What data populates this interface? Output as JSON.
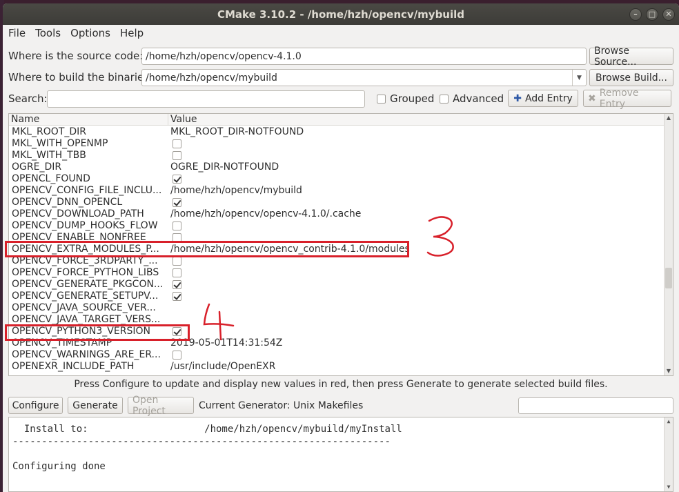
{
  "window": {
    "title": "CMake 3.10.2 - /home/hzh/opencv/mybuild"
  },
  "menu": [
    "File",
    "Tools",
    "Options",
    "Help"
  ],
  "source": {
    "label": "Where is the source code:",
    "value": "/home/hzh/opencv/opencv-4.1.0",
    "button": "Browse Source..."
  },
  "build": {
    "label": "Where to build the binaries:",
    "value": "/home/hzh/opencv/mybuild",
    "button": "Browse Build..."
  },
  "search": {
    "label": "Search:",
    "value": "",
    "grouped": "Grouped",
    "advanced": "Advanced",
    "add_entry": "Add Entry",
    "remove_entry": "Remove Entry"
  },
  "table": {
    "headers": {
      "name": "Name",
      "value": "Value"
    },
    "rows": [
      {
        "name": "MKL_ROOT_DIR",
        "type": "text",
        "value": "MKL_ROOT_DIR-NOTFOUND"
      },
      {
        "name": "MKL_WITH_OPENMP",
        "type": "bool",
        "checked": false
      },
      {
        "name": "MKL_WITH_TBB",
        "type": "bool",
        "checked": false
      },
      {
        "name": "OGRE_DIR",
        "type": "text",
        "value": "OGRE_DIR-NOTFOUND"
      },
      {
        "name": "OPENCL_FOUND",
        "type": "bool",
        "checked": true
      },
      {
        "name": "OPENCV_CONFIG_FILE_INCLU...",
        "type": "text",
        "value": "/home/hzh/opencv/mybuild"
      },
      {
        "name": "OPENCV_DNN_OPENCL",
        "type": "bool",
        "checked": true
      },
      {
        "name": "OPENCV_DOWNLOAD_PATH",
        "type": "text",
        "value": "/home/hzh/opencv/opencv-4.1.0/.cache"
      },
      {
        "name": "OPENCV_DUMP_HOOKS_FLOW",
        "type": "bool",
        "checked": false
      },
      {
        "name": "OPENCV_ENABLE_NONFREE",
        "type": "bool",
        "checked": false
      },
      {
        "name": "OPENCV_EXTRA_MODULES_P...",
        "type": "text",
        "value": "/home/hzh/opencv/opencv_contrib-4.1.0/modules"
      },
      {
        "name": "OPENCV_FORCE_3RDPARTY_...",
        "type": "bool",
        "checked": false
      },
      {
        "name": "OPENCV_FORCE_PYTHON_LIBS",
        "type": "bool",
        "checked": false
      },
      {
        "name": "OPENCV_GENERATE_PKGCON...",
        "type": "bool",
        "checked": true
      },
      {
        "name": "OPENCV_GENERATE_SETUPV...",
        "type": "bool",
        "checked": true
      },
      {
        "name": "OPENCV_JAVA_SOURCE_VER...",
        "type": "text",
        "value": ""
      },
      {
        "name": "OPENCV_JAVA_TARGET_VERS...",
        "type": "text",
        "value": ""
      },
      {
        "name": "OPENCV_PYTHON3_VERSION",
        "type": "bool",
        "checked": true
      },
      {
        "name": "OPENCV_TIMESTAMP",
        "type": "text",
        "value": "2019-05-01T14:31:54Z"
      },
      {
        "name": "OPENCV_WARNINGS_ARE_ER...",
        "type": "bool",
        "checked": false
      },
      {
        "name": "OPENEXR_INCLUDE_PATH",
        "type": "text",
        "value": "/usr/include/OpenEXR"
      }
    ]
  },
  "hint": "Press Configure to update and display new values in red, then press Generate to generate selected build files.",
  "actions": {
    "configure": "Configure",
    "generate": "Generate",
    "open_project": "Open Project",
    "generator": "Current Generator: Unix Makefiles"
  },
  "output": {
    "lines": [
      "  Install to:                    /home/hzh/opencv/mybuild/myInstall",
      "-----------------------------------------------------------------",
      "",
      "Configuring done"
    ]
  },
  "annotations": {
    "color": "#d8202a"
  }
}
